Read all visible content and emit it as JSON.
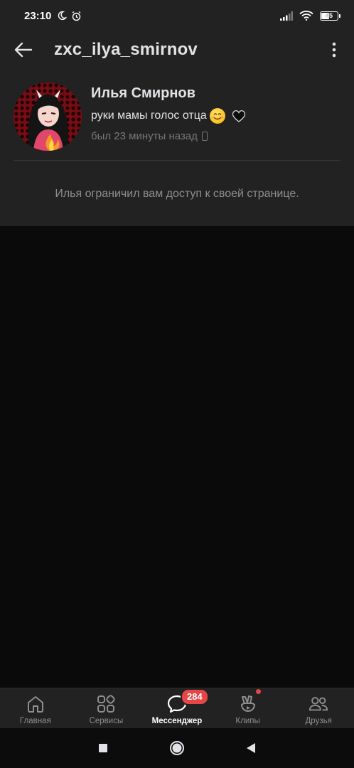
{
  "status_bar": {
    "time": "23:10",
    "battery": "45"
  },
  "header": {
    "title": "zxc_ilya_smirnov"
  },
  "profile": {
    "name": "Илья Смирнов",
    "status": "руки мамы голос отца",
    "last_seen": "был 23 минуты назад",
    "restricted_message": "Илья ограничил вам доступ к своей странице."
  },
  "tab_bar": {
    "items": [
      {
        "label": "Главная",
        "icon": "home-icon"
      },
      {
        "label": "Сервисы",
        "icon": "services-icon"
      },
      {
        "label": "Мессенджер",
        "icon": "messenger-icon",
        "badge": "284"
      },
      {
        "label": "Клипы",
        "icon": "clips-icon"
      },
      {
        "label": "Друзья",
        "icon": "friends-icon"
      }
    ]
  },
  "colors": {
    "background": "#0a0a0a",
    "surface": "#222222",
    "text": "#e1e3e6",
    "secondary_text": "#76787a",
    "badge": "#e64646"
  }
}
